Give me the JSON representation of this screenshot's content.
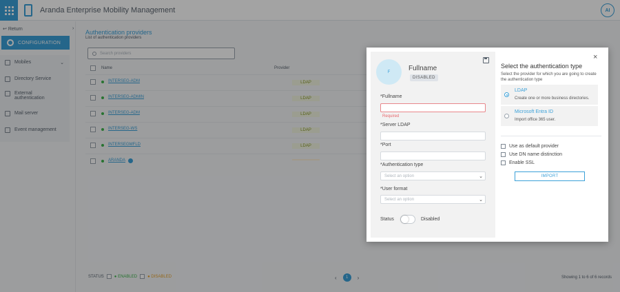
{
  "app": {
    "title": "Aranda Enterprise Mobility Management",
    "user_initials": "AI"
  },
  "sidebar": {
    "return_label": "Return",
    "collapse_label": "›",
    "config_label": "CONFIGURATION",
    "items": [
      {
        "label": "Mobiles",
        "icon": "mobile-icon"
      },
      {
        "label": "Directory Service",
        "icon": "directory-icon"
      },
      {
        "label": "External authentication",
        "icon": "lock-icon"
      },
      {
        "label": "Mail server",
        "icon": "mail-icon"
      },
      {
        "label": "Event management",
        "icon": "chart-icon"
      }
    ]
  },
  "main": {
    "title": "Authentication providers",
    "subtitle": "List of authentication providers",
    "search_placeholder": "Search providers",
    "columns": {
      "name": "Name",
      "provider": "Provider"
    },
    "rows": [
      {
        "name": "INTERSEG-ADM",
        "provider": "LDAP"
      },
      {
        "name": "INTERSEG-ADMIN",
        "provider": "LDAP"
      },
      {
        "name": "INTERSEG-ADM",
        "provider": "LDAP"
      },
      {
        "name": "INTERSEG-WS",
        "provider": "LDAP"
      },
      {
        "name": "INTERSEGMFLD",
        "provider": "LDAP"
      },
      {
        "name": "ARANDA",
        "provider": ""
      }
    ],
    "footer": {
      "status_label": "STATUS",
      "enabled_label": "ENABLED",
      "disabled_label": "DISABLED",
      "page_prev": "‹",
      "page_current": "1",
      "page_next": "›",
      "records_text": "Showing 1 to 6 of 6 records"
    }
  },
  "modal": {
    "avatar_text": "F",
    "name": "Fullname",
    "status_badge": "DISABLED",
    "fields": {
      "fullname_label": "*Fullname",
      "fullname_value": "",
      "required_text": "Required",
      "server_label": "*Server LDAP",
      "port_label": "*Port",
      "auth_type_label": "*Authentication type",
      "auth_type_placeholder": "Select an option",
      "user_format_label": "*User format",
      "user_format_placeholder": "Select an option"
    },
    "status_label": "Status",
    "status_value": "Disabled",
    "close_label": "×",
    "right": {
      "title": "Select the authentication type",
      "description": "Select the provider for which you are going to create the authentication type",
      "options": [
        {
          "title": "LDAP",
          "description": "Create one or more business directories.",
          "selected": true
        },
        {
          "title": "Microsoft Entra ID",
          "description": "Import office 365 user.",
          "selected": false
        }
      ],
      "checks": [
        {
          "label": "Use as default provider"
        },
        {
          "label": "Use DN name distinction"
        },
        {
          "label": "Enable SSL"
        }
      ],
      "import_label": "IMPORT"
    }
  },
  "colors": {
    "accent": "#3aa0d8",
    "enabled": "#3fb44d",
    "disabled": "#e8a22a",
    "error": "#e8686e"
  }
}
